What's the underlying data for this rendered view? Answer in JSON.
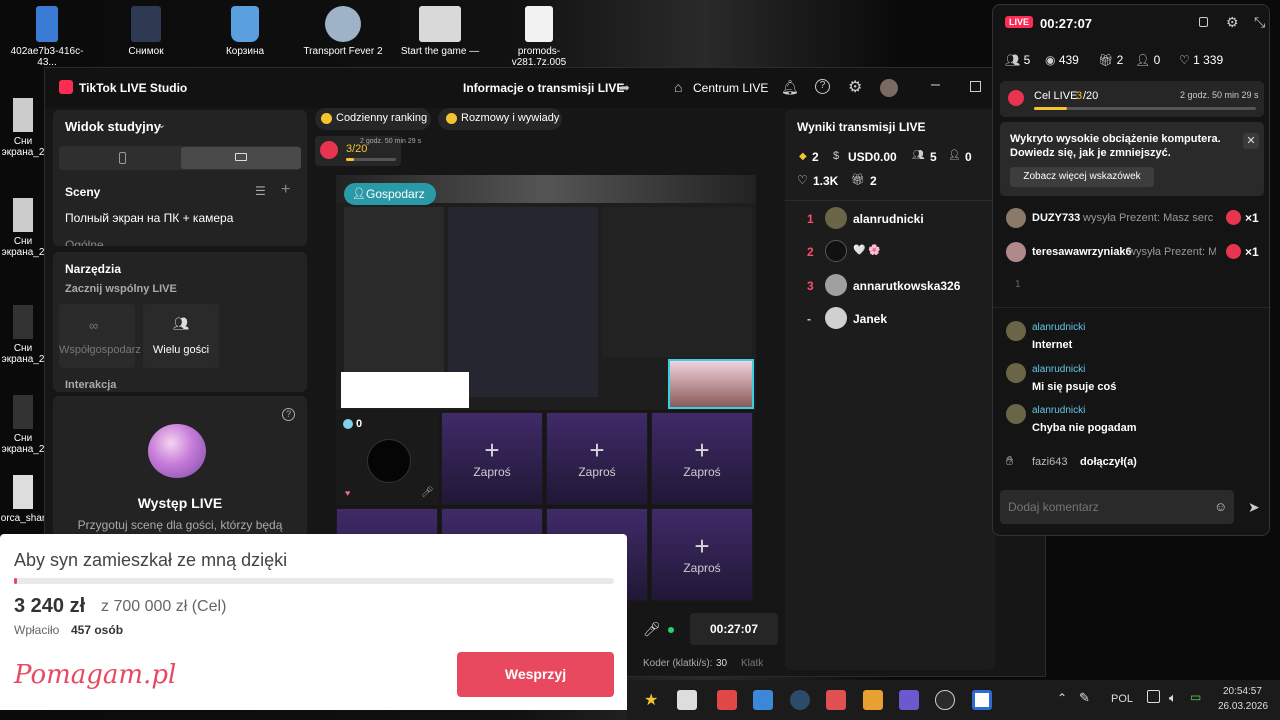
{
  "desktop": {
    "icons": [
      {
        "label": "402ae7b3-416c-43...",
        "color": "#3a7bd5"
      },
      {
        "label": "Снимок",
        "color": "#2d3a52"
      },
      {
        "label": "Корзина",
        "color": "#5aa0e0"
      },
      {
        "label": "Transport Fever 2",
        "color": "#9fb3c8"
      },
      {
        "label": "Start the game —",
        "color": "#d9d9d9"
      },
      {
        "label": "promods-v281.7z.005",
        "color": "#f2f2f2"
      }
    ],
    "side_icons": [
      "Сни экрана_2",
      "Сни экрана_2",
      "Сни экрана_2",
      "Сни экрана_2",
      "orca_shar"
    ]
  },
  "studio": {
    "app_title": "TikTok LIVE Studio",
    "stream_info": "Informacje o transmisji LIVE",
    "live_center": "Centrum LIVE",
    "view_mode": "Widok studyjny",
    "scenes_title": "Sceny",
    "scene_item": "Полный экран на ПК + камера",
    "scene_item_2": "Ogólne",
    "tools_title": "Narzędzia",
    "start_joint": "Zacznij wspólny LIVE",
    "cohost": "Współgospodarz",
    "multi_guest": "Wielu gości",
    "interaction": "Interakcja",
    "live_show_title": "Występ LIVE",
    "live_show_desc": "Przygotuj scenę dla gości, którzy będą",
    "chip_ranking": "Codzienny ranking",
    "chip_talks": "Rozmowy i wywiady",
    "goal_progress": "3/20",
    "goal_time": "2 godz. 50 min 29 s",
    "host_label": "Gospodarz",
    "guest_count": "0",
    "invite_label": "Zaproś",
    "timer": "00:27:07",
    "encoder_label": "Koder (klatki/s):",
    "encoder_value": "30",
    "encoder_extra": "Klatk"
  },
  "results": {
    "title": "Wyniki transmisji LIVE",
    "diamonds": "2",
    "usd": "USD0.00",
    "viewers": "5",
    "followers": "0",
    "likes": "1.3K",
    "gifts": "2",
    "ranking": [
      {
        "rank": "1",
        "name": "alanrudnicki",
        "rank_color": "#ff4d6d",
        "avatar": "#6b6548"
      },
      {
        "rank": "2",
        "name": "🤍 🌸",
        "rank_color": "#ff4d6d",
        "avatar": "#111111"
      },
      {
        "rank": "3",
        "name": "annarutkowska326",
        "rank_color": "#ff4d6d",
        "avatar": "#a0a0a0"
      },
      {
        "rank": "-",
        "name": "Janek",
        "rank_color": "#cccccc",
        "avatar": "#d0d0d0"
      }
    ]
  },
  "live_panel": {
    "badge": "LIVE",
    "timer": "00:27:07",
    "stats": {
      "viewers": "5",
      "views": "439",
      "gifts": "2",
      "follows": "0",
      "likes": "1 339"
    },
    "goal_label": "Cel LIVE",
    "goal_current": "3",
    "goal_total": "/20",
    "goal_fraction": 0.15,
    "goal_time": "2 godz. 50 min 29 s",
    "warning": "Wykryto wysokie obciążenie komputera. Dowiedz się, jak je zmniejszyć.",
    "warning_button": "Zobacz więcej wskazówek",
    "gifts": [
      {
        "user": "DUZY733",
        "text": "wysyła Prezent: Masz serc",
        "count": "×1"
      },
      {
        "user": "teresawawrzyniak6",
        "text": "wysyła Prezent: M",
        "count": "×1"
      }
    ],
    "line_number": "1",
    "comments": [
      {
        "user": "alanrudnicki",
        "text": "Internet"
      },
      {
        "user": "alanrudnicki",
        "text": "Mi się psuje coś"
      },
      {
        "user": "alanrudnicki",
        "text": "Chyba nie pogadam"
      }
    ],
    "join_user": "fazi643",
    "join_text": "dołączył(a)",
    "comment_placeholder": "Dodaj komentarz"
  },
  "fundraiser": {
    "title": "Aby syn zamieszkał ze mną dzięki",
    "raised": "3 240 zł",
    "goal": "z 700 000 zł (Cel)",
    "donors_prefix": "Wpłaciło",
    "donors_count": "457 osób",
    "brand": "Pomagam.pl",
    "button": "Wesprzyj",
    "progress": 0.005
  },
  "taskbar": {
    "language": "POL",
    "time": "20:54:57",
    "date": "26.03.2026"
  }
}
